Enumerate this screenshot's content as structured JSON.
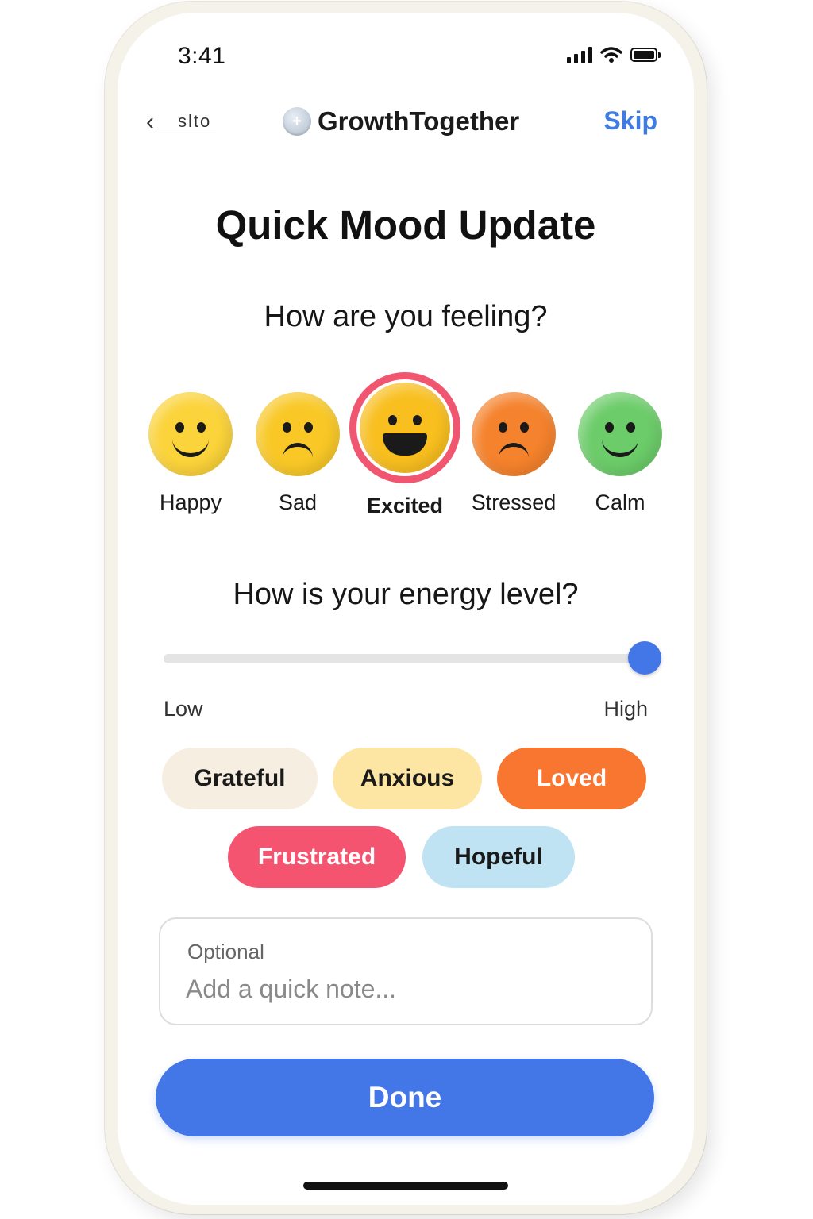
{
  "status_bar": {
    "time": "3:41"
  },
  "nav": {
    "back_label": "slto",
    "brand_logo_glyph": "+",
    "brand_name": "GrowthTogether",
    "skip_label": "Skip"
  },
  "title": "Quick Mood Update",
  "feeling": {
    "question": "How are you feeling?",
    "moods": [
      {
        "label": "Happy",
        "expression": "smile",
        "color": "#fbd33a",
        "selected": false
      },
      {
        "label": "Sad",
        "expression": "frown",
        "color": "#f9c827",
        "selected": false
      },
      {
        "label": "Excited",
        "expression": "grin",
        "color": "#f9bf1f",
        "selected": true
      },
      {
        "label": "Stressed",
        "expression": "frown",
        "color": "#f5822c",
        "selected": false
      },
      {
        "label": "Calm",
        "expression": "smile",
        "color": "#6ccc69",
        "selected": false
      }
    ]
  },
  "energy": {
    "question": "How is your energy level?",
    "min_label": "Low",
    "max_label": "High",
    "value_fraction": 1.0,
    "track_color": "#e4e4e4",
    "thumb_color": "#4377e8"
  },
  "tags": [
    {
      "label": "Grateful",
      "bg": "#f6efe1",
      "fg": "#1a1a1a"
    },
    {
      "label": "Anxious",
      "bg": "#fde6a3",
      "fg": "#1a1a1a"
    },
    {
      "label": "Loved",
      "bg": "#f8762f",
      "fg": "#ffffff"
    },
    {
      "label": "Frustrated",
      "bg": "#f45470",
      "fg": "#ffffff"
    },
    {
      "label": "Hopeful",
      "bg": "#bfe3f3",
      "fg": "#1a1a1a"
    }
  ],
  "note": {
    "label": "Optional",
    "placeholder": "Add a quick note..."
  },
  "done_label": "Done",
  "colors": {
    "accent": "#4377e8",
    "selected_ring": "#f05670",
    "skip": "#3e7be3"
  }
}
